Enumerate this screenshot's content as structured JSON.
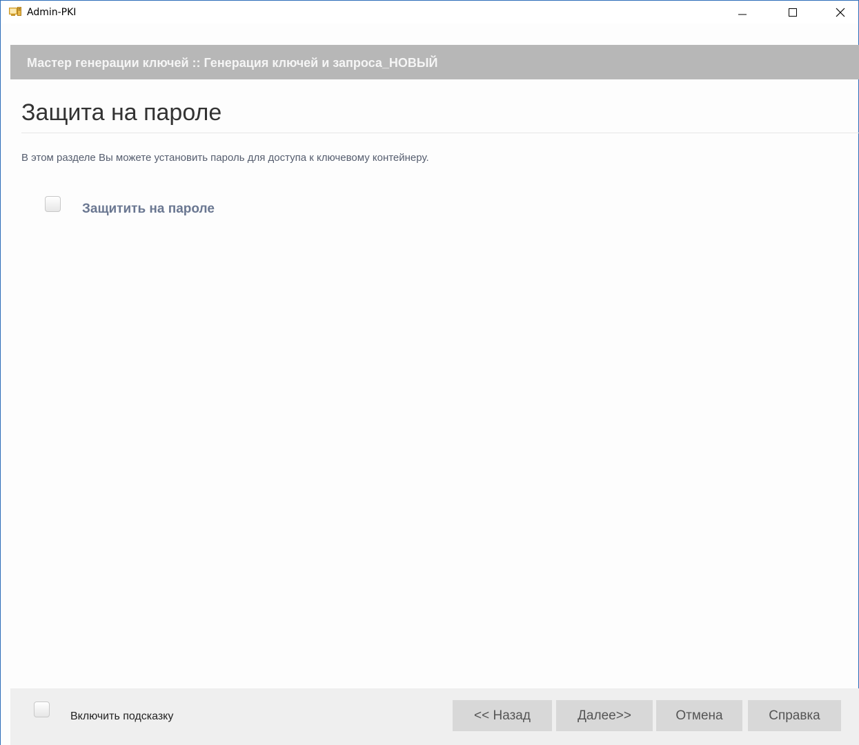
{
  "window": {
    "title": "Admin-PKI",
    "accent": "#2b6cb8"
  },
  "wizard": {
    "header": "Мастер генерации ключей :: Генерация ключей и запроса_НОВЫЙ"
  },
  "main": {
    "title": "Защита на пароле",
    "description": "В этом разделе Вы можете установить пароль для доступа к ключевому контейнеру.",
    "protect_checkbox": {
      "label": "Защитить на пароле",
      "checked": false
    }
  },
  "footer": {
    "hint_checkbox": {
      "label": "Включить подсказку",
      "checked": false
    },
    "buttons": {
      "back": "<< Назад",
      "next": "Далее>>",
      "cancel": "Отмена",
      "help": "Справка"
    }
  }
}
